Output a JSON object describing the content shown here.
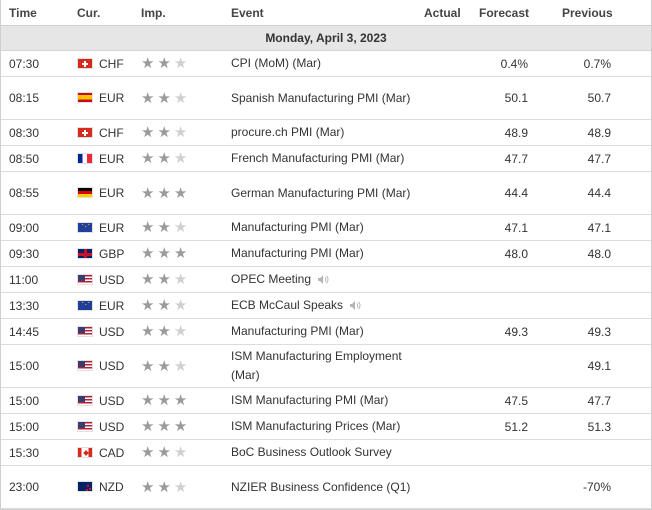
{
  "headers": {
    "time": "Time",
    "cur": "Cur.",
    "imp": "Imp.",
    "event": "Event",
    "actual": "Actual",
    "forecast": "Forecast",
    "previous": "Previous"
  },
  "day_label": "Monday, April 3, 2023",
  "rows": [
    {
      "time": "07:30",
      "cur": "CHF",
      "flag": "ch",
      "imp": 2,
      "event": "CPI (MoM) (Mar)",
      "actual": "",
      "forecast": "0.4%",
      "previous": "0.7%",
      "tall": false,
      "speaker": false
    },
    {
      "time": "08:15",
      "cur": "EUR",
      "flag": "es",
      "imp": 2,
      "event": "Spanish Manufacturing PMI (Mar)",
      "actual": "",
      "forecast": "50.1",
      "previous": "50.7",
      "tall": true,
      "speaker": false
    },
    {
      "time": "08:30",
      "cur": "CHF",
      "flag": "ch",
      "imp": 2,
      "event": "procure.ch PMI (Mar)",
      "actual": "",
      "forecast": "48.9",
      "previous": "48.9",
      "tall": false,
      "speaker": false
    },
    {
      "time": "08:50",
      "cur": "EUR",
      "flag": "fr",
      "imp": 2,
      "event": "French Manufacturing PMI (Mar)",
      "actual": "",
      "forecast": "47.7",
      "previous": "47.7",
      "tall": false,
      "speaker": false
    },
    {
      "time": "08:55",
      "cur": "EUR",
      "flag": "de",
      "imp": 3,
      "event": "German Manufacturing PMI (Mar)",
      "actual": "",
      "forecast": "44.4",
      "previous": "44.4",
      "tall": true,
      "speaker": false
    },
    {
      "time": "09:00",
      "cur": "EUR",
      "flag": "eu",
      "imp": 2,
      "event": "Manufacturing PMI (Mar)",
      "actual": "",
      "forecast": "47.1",
      "previous": "47.1",
      "tall": false,
      "speaker": false
    },
    {
      "time": "09:30",
      "cur": "GBP",
      "flag": "gb",
      "imp": 3,
      "event": "Manufacturing PMI (Mar)",
      "actual": "",
      "forecast": "48.0",
      "previous": "48.0",
      "tall": false,
      "speaker": false
    },
    {
      "time": "11:00",
      "cur": "USD",
      "flag": "us",
      "imp": 2,
      "event": "OPEC Meeting",
      "actual": "",
      "forecast": "",
      "previous": "",
      "tall": false,
      "speaker": true
    },
    {
      "time": "13:30",
      "cur": "EUR",
      "flag": "eu",
      "imp": 2,
      "event": "ECB McCaul Speaks",
      "actual": "",
      "forecast": "",
      "previous": "",
      "tall": false,
      "speaker": true
    },
    {
      "time": "14:45",
      "cur": "USD",
      "flag": "us",
      "imp": 2,
      "event": "Manufacturing PMI (Mar)",
      "actual": "",
      "forecast": "49.3",
      "previous": "49.3",
      "tall": false,
      "speaker": false
    },
    {
      "time": "15:00",
      "cur": "USD",
      "flag": "us",
      "imp": 2,
      "event": "ISM Manufacturing Employment (Mar)",
      "actual": "",
      "forecast": "",
      "previous": "49.1",
      "tall": true,
      "speaker": false
    },
    {
      "time": "15:00",
      "cur": "USD",
      "flag": "us",
      "imp": 3,
      "event": "ISM Manufacturing PMI (Mar)",
      "actual": "",
      "forecast": "47.5",
      "previous": "47.7",
      "tall": false,
      "speaker": false
    },
    {
      "time": "15:00",
      "cur": "USD",
      "flag": "us",
      "imp": 3,
      "event": "ISM Manufacturing Prices (Mar)",
      "actual": "",
      "forecast": "51.2",
      "previous": "51.3",
      "tall": false,
      "speaker": false
    },
    {
      "time": "15:30",
      "cur": "CAD",
      "flag": "ca",
      "imp": 2,
      "event": "BoC Business Outlook Survey",
      "actual": "",
      "forecast": "",
      "previous": "",
      "tall": false,
      "speaker": false
    },
    {
      "time": "23:00",
      "cur": "NZD",
      "flag": "nz",
      "imp": 2,
      "event": "NZIER Business Confidence (Q1)",
      "actual": "",
      "forecast": "",
      "previous": "-70%",
      "tall": true,
      "speaker": false
    }
  ]
}
